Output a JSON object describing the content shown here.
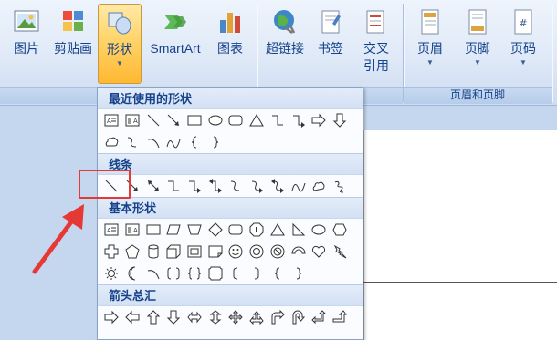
{
  "ribbon": {
    "buttons": [
      {
        "label": "图片",
        "icon": "picture-icon"
      },
      {
        "label": "剪贴画",
        "icon": "clipart-icon"
      },
      {
        "label": "形状",
        "icon": "shapes-icon",
        "has_dropdown": true,
        "active": true
      },
      {
        "label": "SmartArt",
        "icon": "smartart-icon"
      },
      {
        "label": "图表",
        "icon": "chart-icon"
      },
      {
        "label": "超链接",
        "icon": "hyperlink-icon"
      },
      {
        "label": "书签",
        "icon": "bookmark-icon"
      },
      {
        "label": "交叉",
        "label2": "引用",
        "icon": "cross-reference-icon"
      },
      {
        "label": "页眉",
        "icon": "header-icon",
        "has_dropdown": true
      },
      {
        "label": "页脚",
        "icon": "footer-icon",
        "has_dropdown": true
      },
      {
        "label": "页码",
        "icon": "page-number-icon",
        "has_dropdown": true
      }
    ],
    "group_title_header_footer": "页眉和页脚"
  },
  "dropdown": {
    "categories": [
      {
        "title": "最近使用的形状",
        "rows": [
          12,
          6
        ]
      },
      {
        "title": "线条",
        "rows": [
          12
        ]
      },
      {
        "title": "基本形状",
        "rows": [
          12,
          12,
          11
        ]
      },
      {
        "title": "箭头总汇",
        "rows": [
          12
        ]
      }
    ],
    "highlighted_shape": "line-icon"
  },
  "colors": {
    "accent_active": "#ffd46a",
    "highlight_border": "#e53935",
    "ribbon_text": "#15428b"
  }
}
